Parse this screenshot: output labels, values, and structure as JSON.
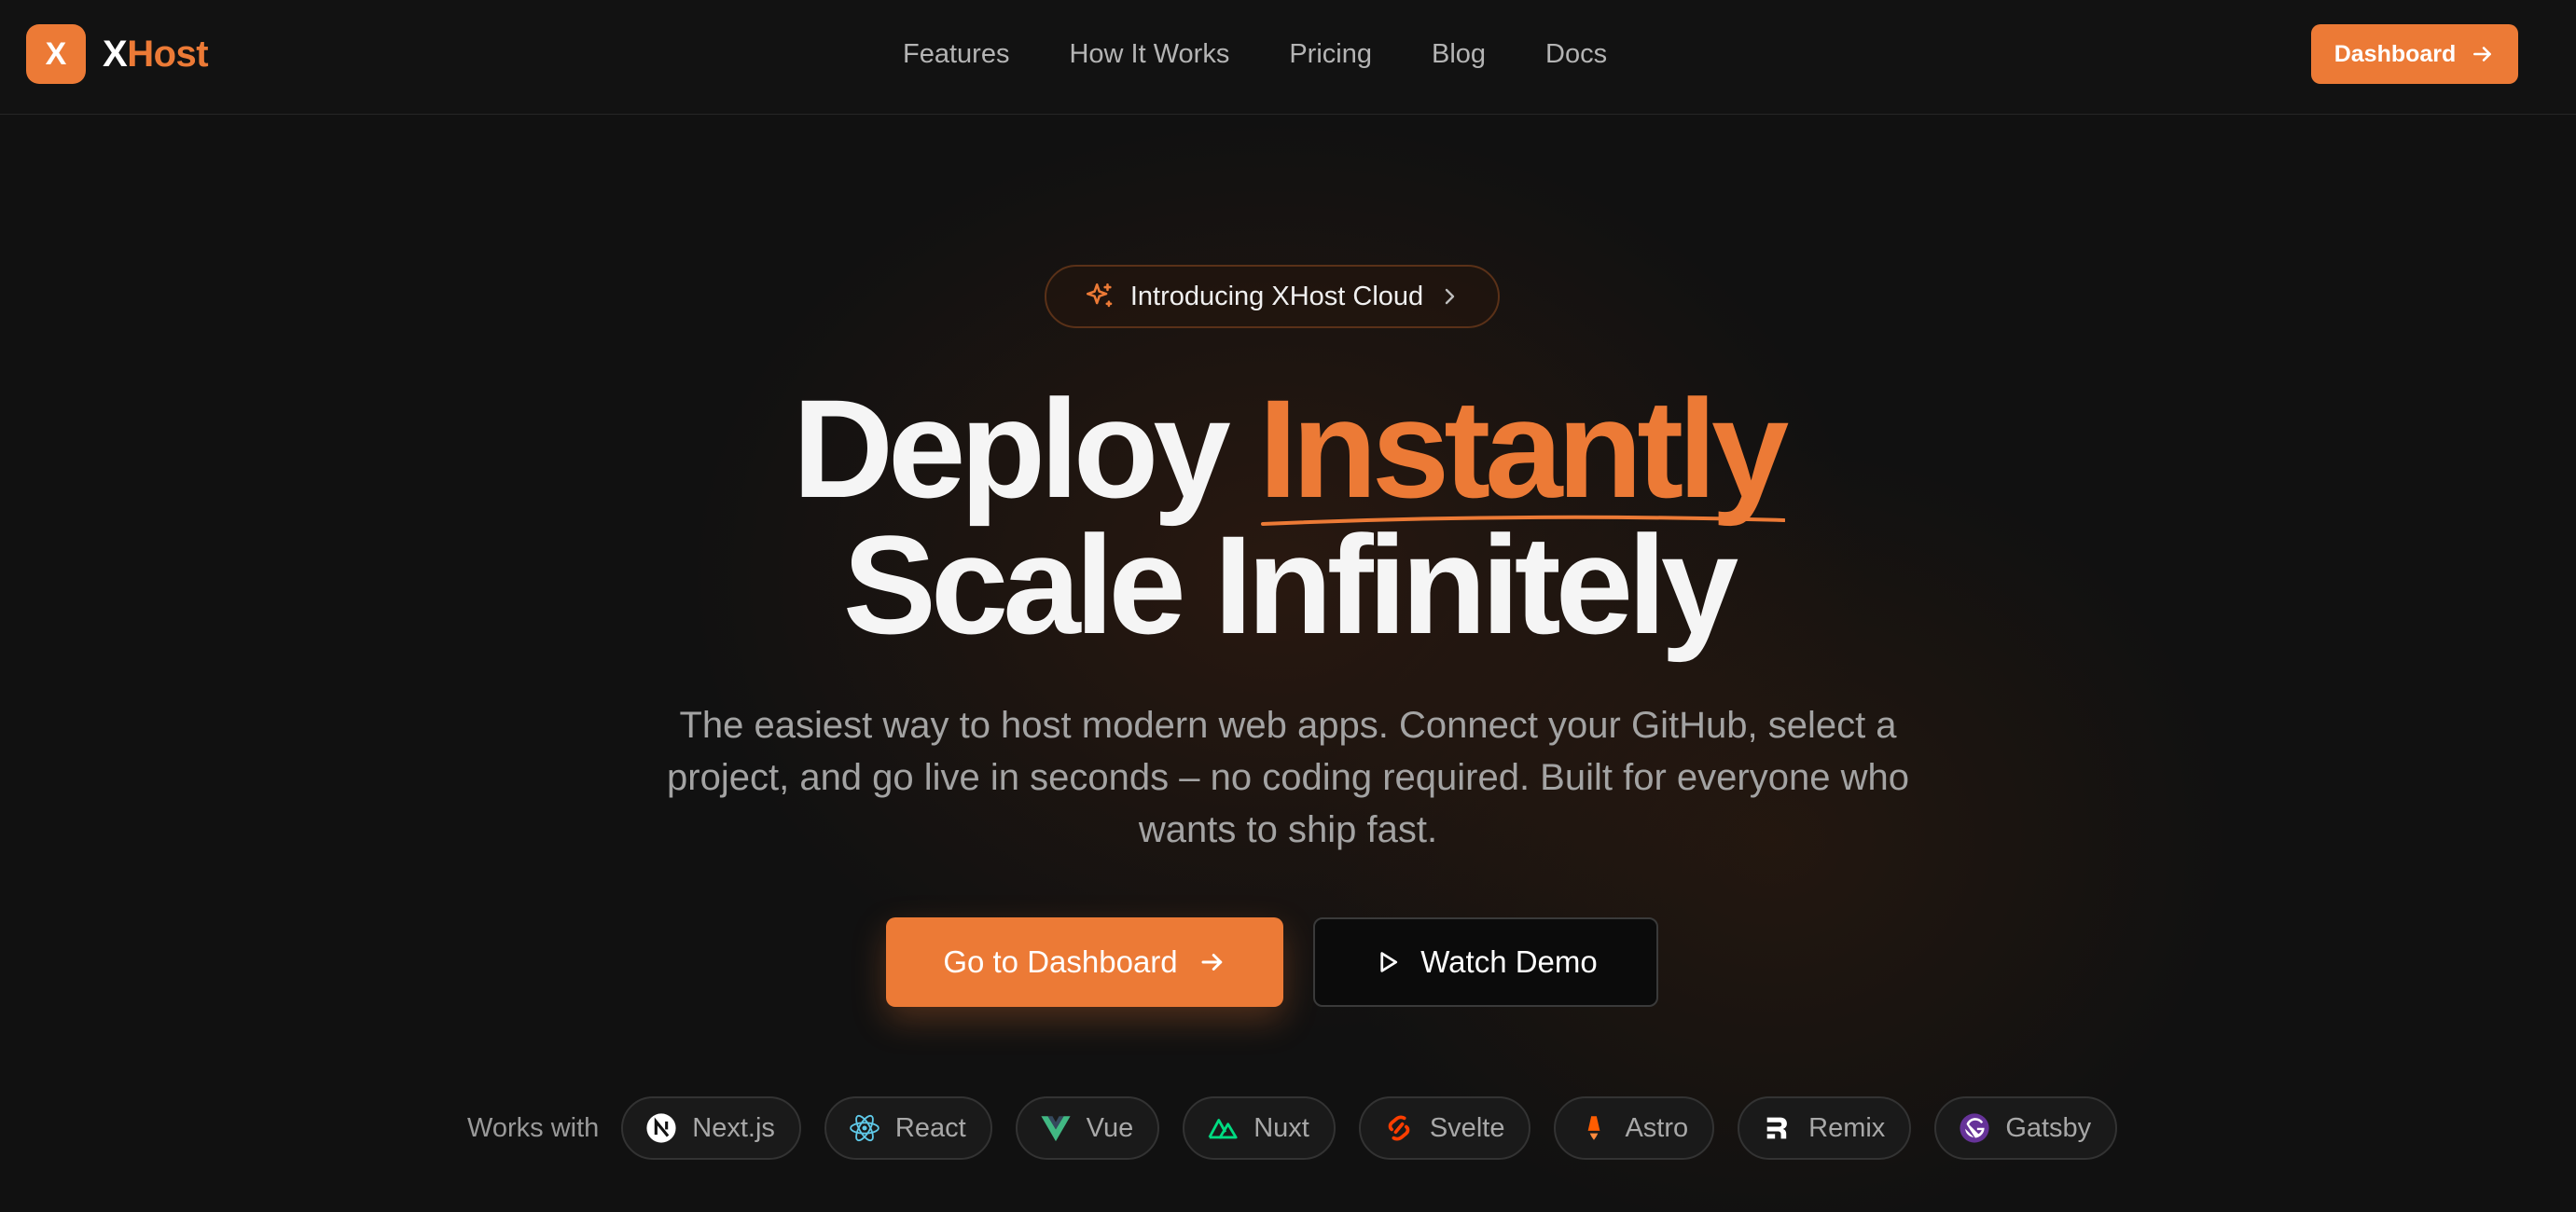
{
  "brand": {
    "mark": "X",
    "name_x": "X",
    "name_host": "Host",
    "accent": "#ec7a36"
  },
  "nav": {
    "links": [
      "Features",
      "How It Works",
      "Pricing",
      "Blog",
      "Docs"
    ],
    "cta_label": "Dashboard",
    "cta_icon": "arrow-right-icon"
  },
  "hero": {
    "badge": {
      "icon": "sparkles-icon",
      "label": "Introducing XHost Cloud",
      "trailing_icon": "chevron-right-icon"
    },
    "headline_line1_plain": "Deploy",
    "headline_line1_accent": "Instantly",
    "headline_line2": "Scale Infinitely",
    "subtitle": "The easiest way to host modern web apps. Connect your GitHub, select a project, and go live in seconds – no coding required. Built for everyone who wants to ship fast.",
    "primary_button": {
      "label": "Go to Dashboard",
      "icon": "arrow-right-icon"
    },
    "secondary_button": {
      "label": "Watch Demo",
      "icon": "play-icon"
    }
  },
  "works_with": {
    "label": "Works with",
    "frameworks": [
      {
        "name": "Next.js",
        "icon": "nextjs-icon"
      },
      {
        "name": "React",
        "icon": "react-icon"
      },
      {
        "name": "Vue",
        "icon": "vue-icon"
      },
      {
        "name": "Nuxt",
        "icon": "nuxt-icon"
      },
      {
        "name": "Svelte",
        "icon": "svelte-icon"
      },
      {
        "name": "Astro",
        "icon": "astro-icon"
      },
      {
        "name": "Remix",
        "icon": "remix-icon"
      },
      {
        "name": "Gatsby",
        "icon": "gatsby-icon"
      }
    ]
  }
}
